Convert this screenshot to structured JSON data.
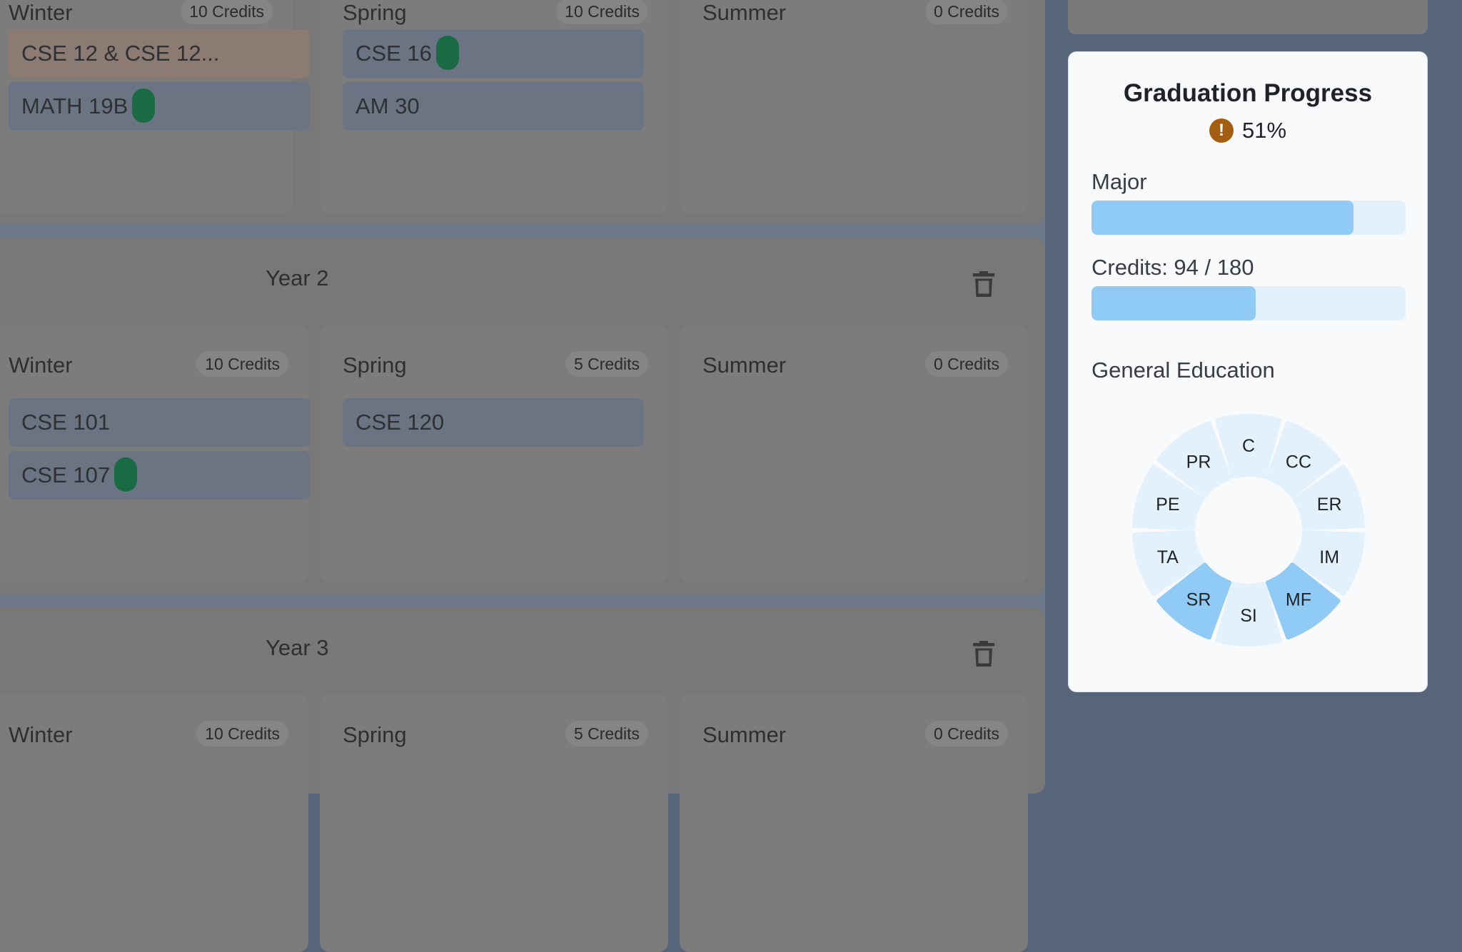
{
  "planner": {
    "years": [
      {
        "title": "",
        "quarters": [
          {
            "name": "Winter",
            "credits": "10 Credits",
            "courses": [
              {
                "label": "CSE 12 & CSE 12...",
                "warn": true,
                "badge": false
              },
              {
                "label": "MATH 19B",
                "warn": false,
                "badge": true
              }
            ]
          },
          {
            "name": "Spring",
            "credits": "10 Credits",
            "courses": [
              {
                "label": "CSE 16",
                "warn": false,
                "badge": true
              },
              {
                "label": "AM 30",
                "warn": false,
                "badge": false
              }
            ]
          },
          {
            "name": "Summer",
            "credits": "0 Credits",
            "courses": []
          }
        ]
      },
      {
        "title": "Year 2",
        "quarters": [
          {
            "name": "Winter",
            "credits": "10 Credits",
            "courses": [
              {
                "label": "CSE 101",
                "warn": false,
                "badge": false
              },
              {
                "label": "CSE 107",
                "warn": false,
                "badge": true
              }
            ]
          },
          {
            "name": "Spring",
            "credits": "5 Credits",
            "courses": [
              {
                "label": "CSE 120",
                "warn": false,
                "badge": false
              }
            ]
          },
          {
            "name": "Summer",
            "credits": "0 Credits",
            "courses": []
          }
        ]
      },
      {
        "title": "Year 3",
        "quarters": [
          {
            "name": "Winter",
            "credits": "10 Credits",
            "courses": []
          },
          {
            "name": "Spring",
            "credits": "5 Credits",
            "courses": []
          },
          {
            "name": "Summer",
            "credits": "0 Credits",
            "courses": []
          }
        ]
      }
    ]
  },
  "progress": {
    "title": "Graduation Progress",
    "percent": "51%",
    "status_icon": "warning-icon",
    "major_label": "Major",
    "major_fraction": 0.835,
    "credits_label": "Credits: 94 / 180",
    "credits_fraction": 0.522,
    "ge_label": "General Education",
    "ge_segments": [
      {
        "code": "C",
        "done": false
      },
      {
        "code": "CC",
        "done": false
      },
      {
        "code": "ER",
        "done": false
      },
      {
        "code": "IM",
        "done": false
      },
      {
        "code": "MF",
        "done": true
      },
      {
        "code": "SI",
        "done": false
      },
      {
        "code": "SR",
        "done": true
      },
      {
        "code": "TA",
        "done": false
      },
      {
        "code": "PE",
        "done": false
      },
      {
        "code": "PR",
        "done": false
      }
    ]
  },
  "colors": {
    "badge": "#1a6b44",
    "bar_fill": "#90cbf6",
    "bar_track": "#e3f1fc",
    "ge_done": "#90cbf6",
    "ge_todo": "#e3f1fc",
    "warning": "#a45e12"
  }
}
